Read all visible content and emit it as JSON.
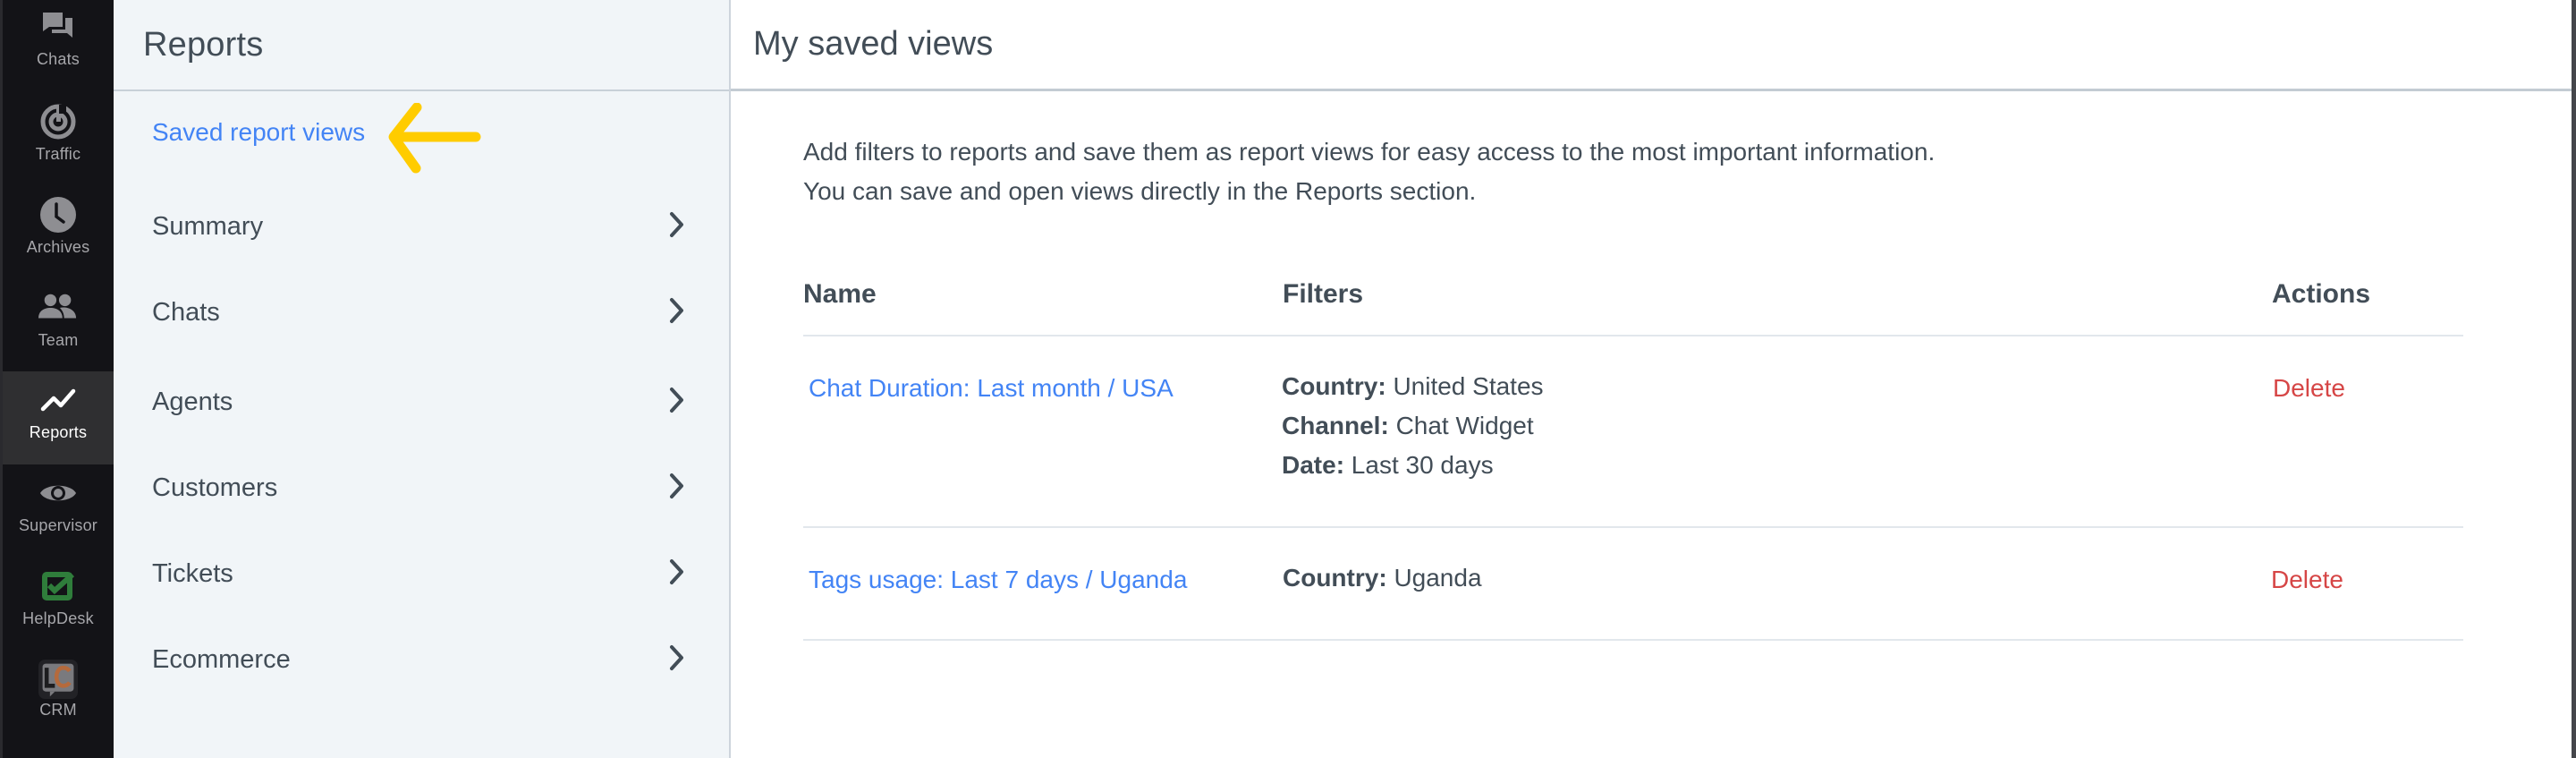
{
  "rail": {
    "items": [
      {
        "label": "Chats",
        "icon": "chats-icon",
        "active": false
      },
      {
        "label": "Traffic",
        "icon": "traffic-icon",
        "active": false
      },
      {
        "label": "Archives",
        "icon": "archives-clock-icon",
        "active": false
      },
      {
        "label": "Team",
        "icon": "team-icon",
        "active": false
      },
      {
        "label": "Reports",
        "icon": "reports-chart-icon",
        "active": true
      },
      {
        "label": "Supervisor",
        "icon": "supervisor-eye-icon",
        "active": false
      },
      {
        "label": "HelpDesk",
        "icon": "helpdesk-check-icon",
        "active": false
      },
      {
        "label": "CRM",
        "icon": "crm-lc-icon",
        "active": false
      }
    ]
  },
  "subnav": {
    "title": "Reports",
    "saved_link": "Saved report views",
    "items": [
      {
        "label": "Summary"
      },
      {
        "label": "Chats"
      },
      {
        "label": "Agents"
      },
      {
        "label": "Customers"
      },
      {
        "label": "Tickets"
      },
      {
        "label": "Ecommerce"
      }
    ]
  },
  "main": {
    "title": "My saved views",
    "description": [
      "Add filters to reports and save them as report views for easy access to the most important information.",
      "You can save and open views directly in the Reports section."
    ],
    "table": {
      "headers": {
        "name": "Name",
        "filters": "Filters",
        "actions": "Actions"
      },
      "rows": [
        {
          "name": "Chat Duration: Last month / USA",
          "filters": [
            {
              "key": "Country:",
              "value": "United States"
            },
            {
              "key": "Channel:",
              "value": "Chat Widget"
            },
            {
              "key": "Date:",
              "value": "Last 30 days"
            }
          ],
          "action": "Delete"
        },
        {
          "name": "Tags usage: Last 7 days / Uganda",
          "filters": [
            {
              "key": "Country:",
              "value": "Uganda"
            }
          ],
          "action": "Delete"
        }
      ]
    }
  },
  "colors": {
    "accent_link": "#4384f5",
    "delete": "#d64646",
    "annotation_arrow": "#ffcc00",
    "rail_bg": "#131317",
    "subnav_bg": "#f1f5f8"
  }
}
